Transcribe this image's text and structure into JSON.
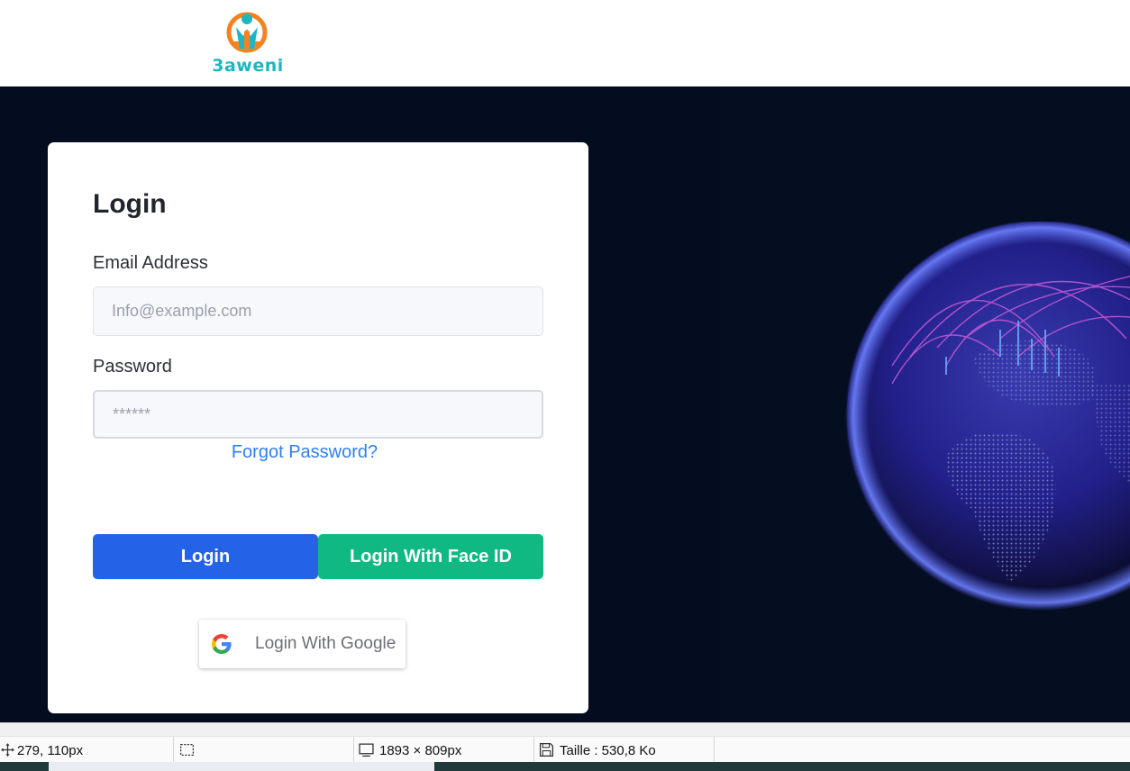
{
  "header": {
    "logo_text": "3aweni",
    "logo_icon": "person-info-icon"
  },
  "login": {
    "title": "Login",
    "email_label": "Email Address",
    "email_placeholder": "Info@example.com",
    "email_value": "",
    "password_label": "Password",
    "password_placeholder": "******",
    "password_value": "",
    "forgot_link": "Forgot Password?",
    "login_button": "Login",
    "face_id_button": "Login With Face ID",
    "google_button": "Login With Google",
    "google_icon": "google-g-icon"
  },
  "colors": {
    "login_button": "#2563e6",
    "face_id_button": "#10b981",
    "link": "#2f80ed",
    "hero_background": "#040c1f",
    "logo_orange": "#f58220",
    "logo_teal": "#1fb6c1"
  },
  "statusbar": {
    "cursor_position": "279, 110px",
    "selection": "",
    "image_size": "1893 × 809px",
    "file_size": "Taille : 530,8 Ko",
    "icons": [
      "move-cursor-icon",
      "selection-icon",
      "image-size-icon",
      "save-disk-icon"
    ]
  }
}
